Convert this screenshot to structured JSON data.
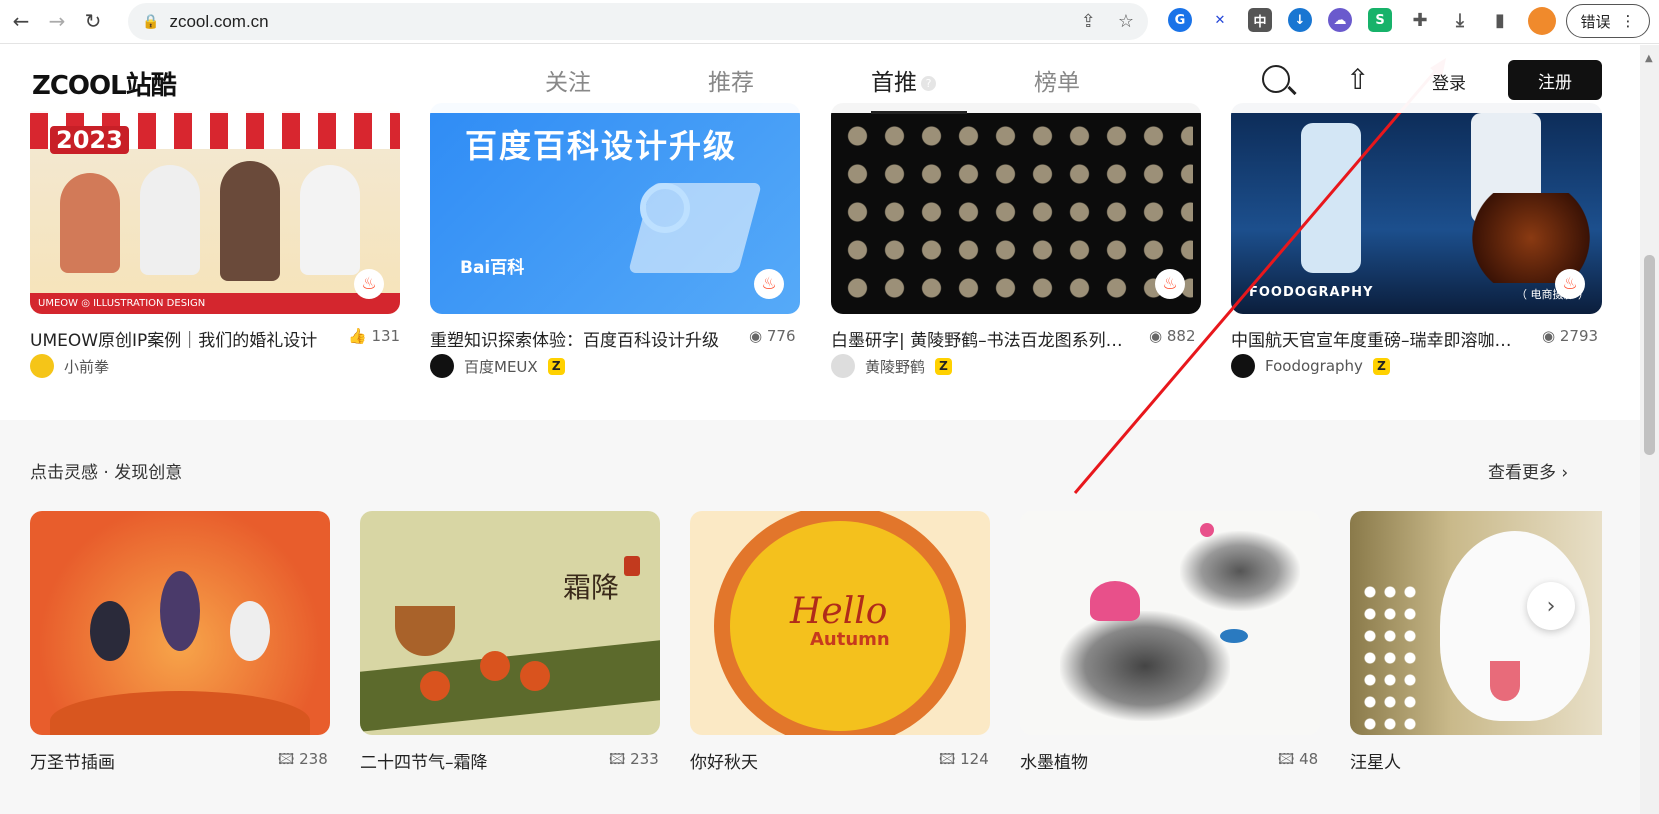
{
  "browser": {
    "url": "zcool.com.cn",
    "error_label": "错误"
  },
  "header": {
    "logo": "ZCOOL站酷",
    "tabs": [
      "关注",
      "推荐",
      "首推",
      "榜单"
    ],
    "login": "登录",
    "register": "注册"
  },
  "works": [
    {
      "title": "UMEOW原创IP案例｜我们的婚礼设计",
      "stat": "131",
      "stat_icon": "like-icon",
      "author": "小前拳",
      "badge": ""
    },
    {
      "title": "重塑知识探索体验：百度百科设计升级",
      "stat": "776",
      "stat_icon": "eye-icon",
      "author": "百度MEUX",
      "badge": "Z"
    },
    {
      "title": "白墨研字| 黄陵野鹤–书法百龙图系列…",
      "stat": "882",
      "stat_icon": "eye-icon",
      "author": "黄陵野鹤",
      "badge": "Z"
    },
    {
      "title": "中国航天官宣年度重磅–瑞幸即溶咖…",
      "stat": "2793",
      "stat_icon": "eye-icon",
      "author": "Foodography",
      "badge": "Z"
    }
  ],
  "work_thumb_text": {
    "w1_year": "2023",
    "w1_caption": "UMEOW ◎ ILLUSTRATION DESIGN",
    "w2_headline": "百度百科设计升级",
    "w2_logo": "Bai百科",
    "w4_brand": "FOODOGRAPHY",
    "w4_tag": "（ 电商摄影 ）"
  },
  "inspiration": {
    "title": "点击灵感 · 发现创意",
    "more": "查看更多",
    "items": [
      {
        "title": "万圣节插画",
        "count": "238"
      },
      {
        "title": "二十四节气–霜降",
        "count": "233"
      },
      {
        "title": "你好秋天",
        "count": "124"
      },
      {
        "title": "水墨植物",
        "count": "48"
      },
      {
        "title": "汪星人",
        "count": ""
      }
    ],
    "thumb_text": {
      "frost": "霜降",
      "hello": "Hello",
      "autumn": "Autumn"
    }
  }
}
